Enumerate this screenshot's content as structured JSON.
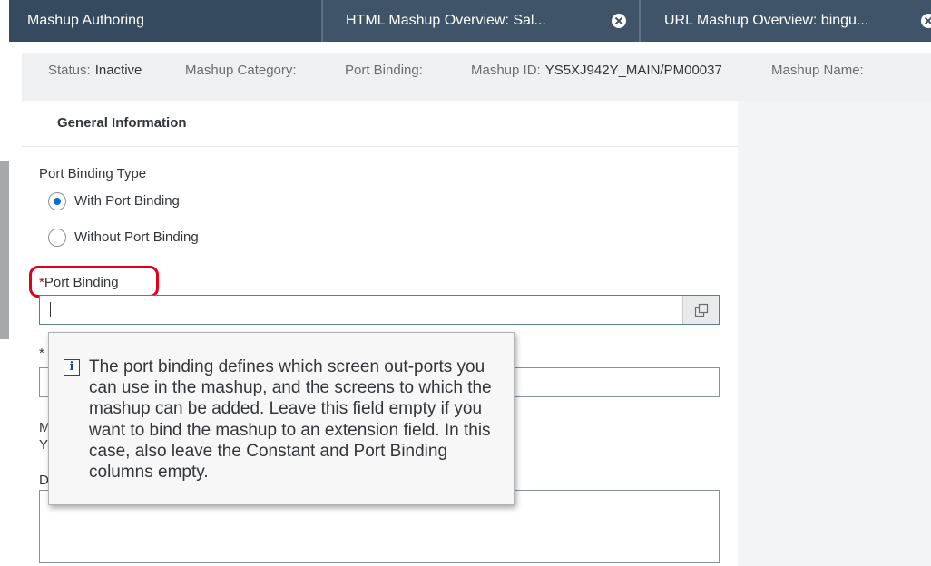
{
  "tabs": [
    {
      "label": "Mashup Authoring",
      "closable": false
    },
    {
      "label": "HTML Mashup Overview: Sal...",
      "closable": true
    },
    {
      "label": "URL Mashup Overview: bingu...",
      "closable": true
    }
  ],
  "header": {
    "status_label": "Status:",
    "status_value": "Inactive",
    "category_label": "Mashup Category:",
    "port_binding_label": "Port Binding:",
    "mashup_id_label": "Mashup ID:",
    "mashup_id_value": "YS5XJ942Y_MAIN/PM00037",
    "mashup_name_label": "Mashup Name:"
  },
  "section": {
    "title": "General Information"
  },
  "form": {
    "port_binding_type_label": "Port Binding Type",
    "radio_with": "With Port Binding",
    "radio_without": "Without Port Binding",
    "selected": "with",
    "required_marker": "*",
    "port_binding_label": "Port Binding",
    "port_binding_value": "",
    "partial_label_m": "M",
    "partial_label_y": "Y",
    "partial_label_d": "D"
  },
  "tooltip": {
    "text": "The port binding defines which screen out-ports you can use in the mashup, and the screens to which the mashup can be added. Leave this field empty if you want to bind the mashup to an extension field. In this case, also leave the Constant and Port Binding columns empty."
  },
  "colors": {
    "tabbar": "#354a5f",
    "accent": "#0a6ed1",
    "highlight": "#e0001b",
    "required": "#bb0000"
  },
  "icons": {
    "close": "close-circle-icon",
    "value_help": "value-help-icon",
    "info": "info-icon"
  }
}
